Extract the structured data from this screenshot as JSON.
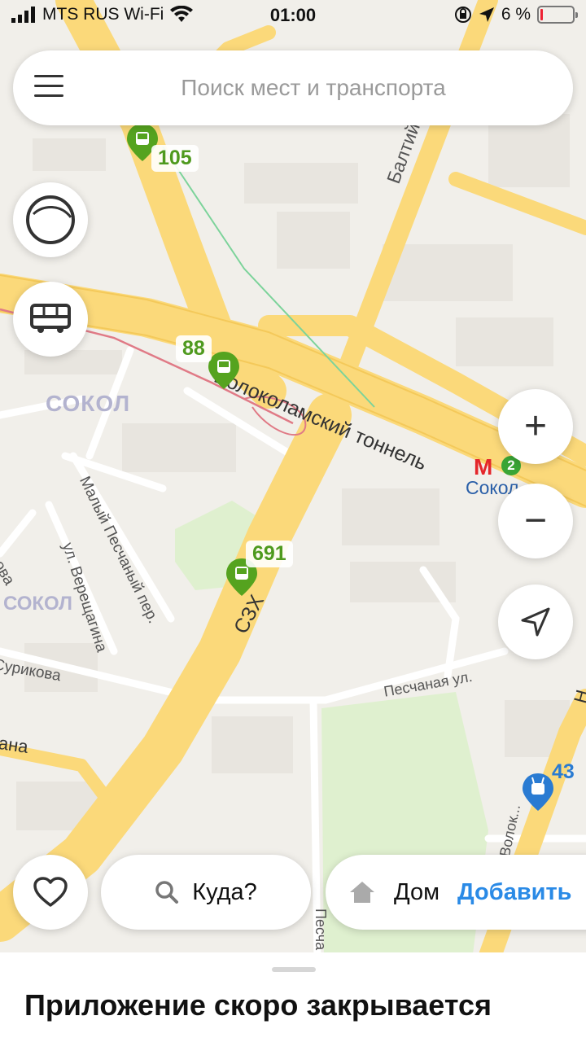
{
  "status_bar": {
    "carrier": "MTS RUS Wi-Fi",
    "time": "01:00",
    "battery": "6 %",
    "battery_level_percent": 6
  },
  "search": {
    "placeholder": "Поиск мест и транспорта"
  },
  "map": {
    "stops": {
      "s105": "105",
      "s88": "88",
      "s691": "691",
      "s43": "43"
    },
    "labels": {
      "district_sokol_1": "СОКОЛ",
      "district_sokol_2": "СОКОЛ",
      "street_baltiyskaya": "Балтийская ул.",
      "tunnel_volokolamsky": "Волоколамский тоннель",
      "metro_sokol": "Сокол",
      "metro_line": "2",
      "street_maly_peschany": "Малый Песчаный пер.",
      "street_vereshchagina": "ул. Верещагина",
      "street_tarasova": "Тарасова",
      "street_surikova": "Сурикова",
      "street_peschanaya": "Песчаная ул.",
      "street_szkh": "СЗХ",
      "street_ana": "ана",
      "street_pescha_vertical": "Песча",
      "street_n": "Н",
      "street_vol": "Волок..."
    }
  },
  "controls": {
    "zoom_in": "+",
    "zoom_out": "−"
  },
  "bottom": {
    "where_label": "Куда?",
    "home_label": "Дом",
    "add_label": "Добавить"
  },
  "sheet": {
    "title": "Приложение скоро закрывается"
  },
  "colors": {
    "road_major": "#fbd97a",
    "road_minor": "#ffffff",
    "park": "#dff0cf",
    "transit_green": "#55a31f",
    "trolley_blue": "#2a7bd2",
    "metro_red": "#e4262b",
    "accent_link": "#2a8ae6"
  }
}
